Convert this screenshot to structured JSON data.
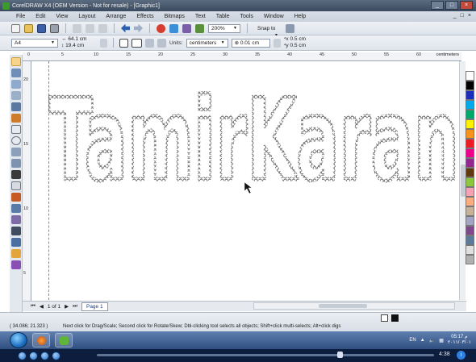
{
  "window": {
    "title": "CorelDRAW X4 (OEM Version - Not for resale) - [Graphic1]",
    "buttons": [
      "_",
      "□",
      "×"
    ]
  },
  "menubar": {
    "items": [
      "File",
      "Edit",
      "View",
      "Layout",
      "Arrange",
      "Effects",
      "Bitmaps",
      "Text",
      "Table",
      "Tools",
      "Window",
      "Help"
    ],
    "mdi_buttons": [
      "_",
      "□",
      "×"
    ]
  },
  "toolbar": {
    "zoom": "200%",
    "snap_to": "Snap to"
  },
  "propbar": {
    "page_size": "A4",
    "width": "64.1 cm",
    "height": "19.4 cm",
    "units_label": "Units:",
    "units": "centimeters",
    "nudge": "0.01 cm",
    "dup_x": "0.5 cm",
    "dup_y": "0.5 cm"
  },
  "ruler": {
    "unit": "centimeters",
    "h_ticks": [
      "0",
      "5",
      "10",
      "15",
      "20",
      "25",
      "30",
      "35",
      "40",
      "45",
      "50",
      "55",
      "60"
    ],
    "v_ticks": [
      "20",
      "15",
      "10",
      "5"
    ]
  },
  "canvas": {
    "artwork_text": "TamirKaran"
  },
  "pagebar": {
    "page_count": "1 of 1",
    "page_tab": "Page 1"
  },
  "status": {
    "coords": "( 34.086; 21.323 )",
    "hint": "Next click for Drag/Scale; Second click for Rotate/Skew; Dbl-clicking tool selects all objects; Shift+click multi-selects; Alt+click digs"
  },
  "taskbar": {
    "language": "EN",
    "clock_time": "05:17 م",
    "clock_date": "٢٠١١/٠٣/٠١"
  },
  "player": {
    "elapsed": "4:38",
    "progress": 0.72
  },
  "palette_colors": [
    "#ffffff",
    "#000000",
    "#1a2eb8",
    "#00a9e8",
    "#00a76a",
    "#fff200",
    "#f7941d",
    "#ed1c24",
    "#ec008c",
    "#92278f",
    "#603913",
    "#8dc63f",
    "#f6a2b5",
    "#f9ad81",
    "#c7b299",
    "#a3a3c2",
    "#7f4a8a",
    "#5c7b9a",
    "#e0e0e0",
    "#b0b0b0"
  ]
}
